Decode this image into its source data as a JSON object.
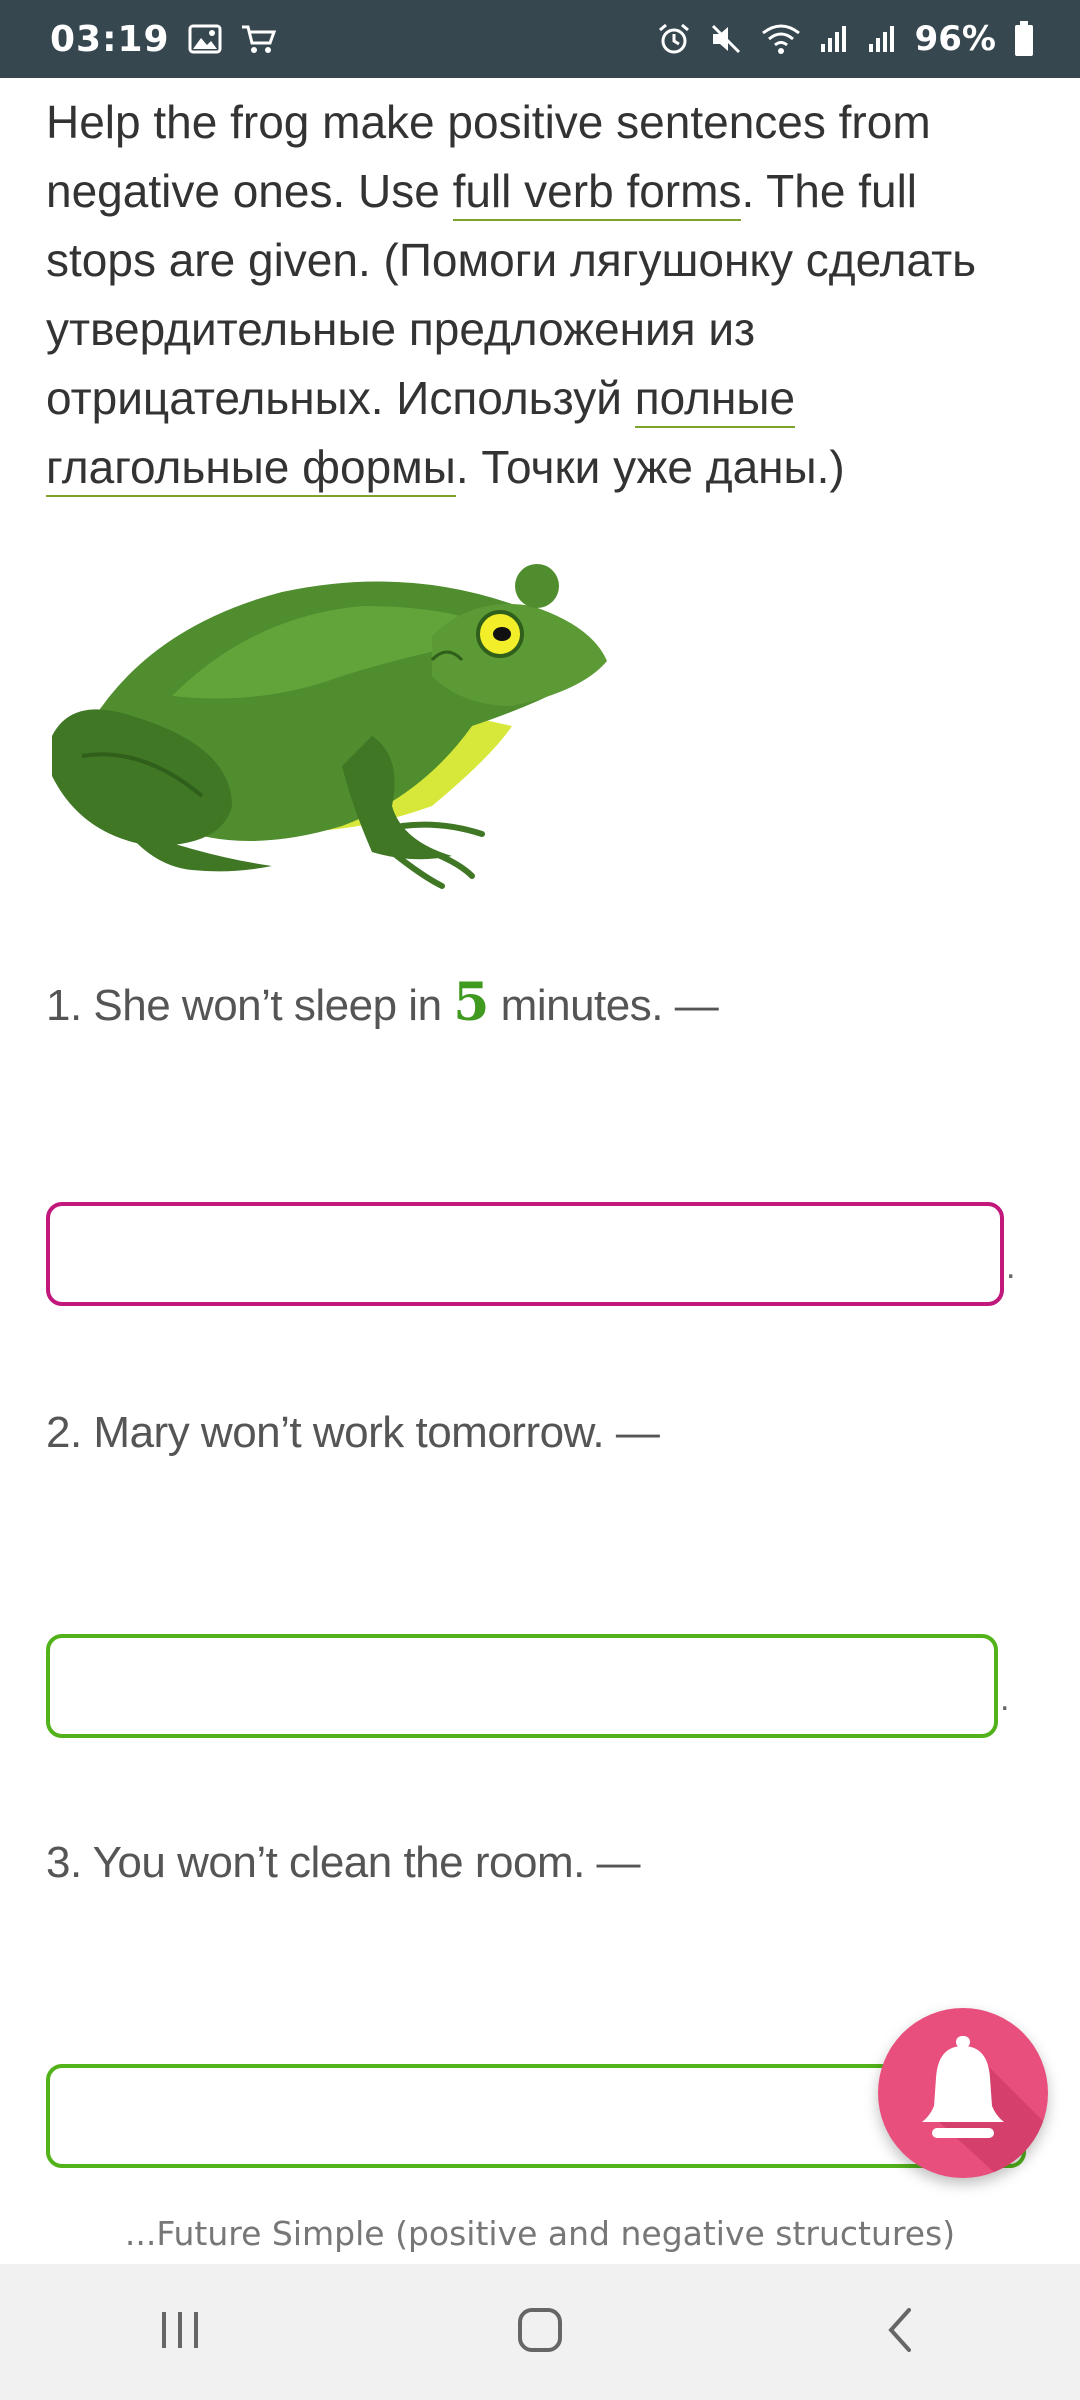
{
  "status_bar": {
    "time": "03:19",
    "battery_percent": "96%",
    "left_icons": [
      "gallery-icon",
      "cart-icon"
    ],
    "right_icons": [
      "alarm-icon",
      "mute-icon",
      "wifi-icon",
      "signal-icon",
      "signal-icon",
      "battery-icon"
    ]
  },
  "instructions": {
    "part1": "Help the frog make positive sentences from negative ones. Use ",
    "term1": "full verb forms",
    "part2": ". The full stops are given. (Помоги лягушонку сделать утвердительные предложения из отрицательных. Используй ",
    "term2": "полные глагольные формы",
    "part3": ". Точки уже даны.)"
  },
  "questions": [
    {
      "prefix": "1. She won’t sleep in ",
      "highlight": "5",
      "suffix": " minutes. —",
      "answer": "",
      "stop": "."
    },
    {
      "text": "2. Mary won’t work tomorrow. —",
      "answer": "",
      "stop": "."
    },
    {
      "text": "3. You won’t clean the room. —",
      "answer": ""
    }
  ],
  "fab": {
    "icon": "bell-icon"
  },
  "footer": {
    "title": "...Future Simple (positive and negative structures)"
  },
  "nav_bar": {
    "icons": [
      "recents-icon",
      "home-icon",
      "back-icon"
    ]
  },
  "colors": {
    "status_bar": "#37474f",
    "accent_green": "#52b21a",
    "active_border": "#c2187b",
    "fab": "#e94f7d"
  }
}
